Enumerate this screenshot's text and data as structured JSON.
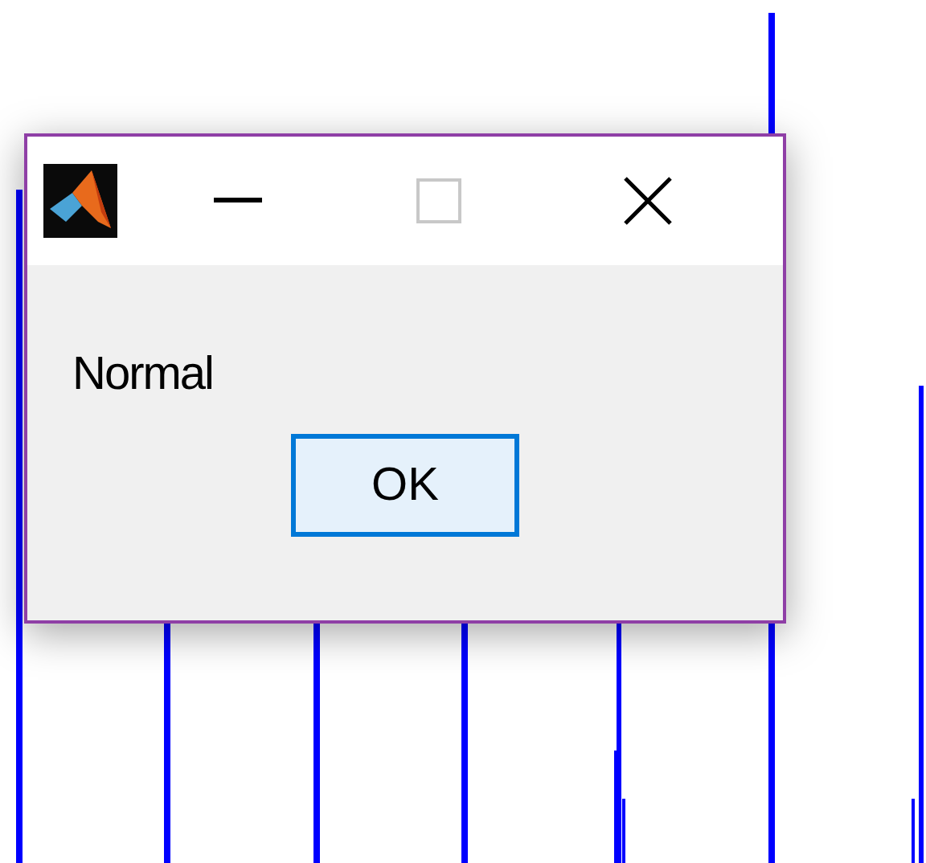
{
  "dialog": {
    "message": "Normal",
    "buttons": [
      {
        "label": "OK",
        "focused": true
      }
    ]
  }
}
